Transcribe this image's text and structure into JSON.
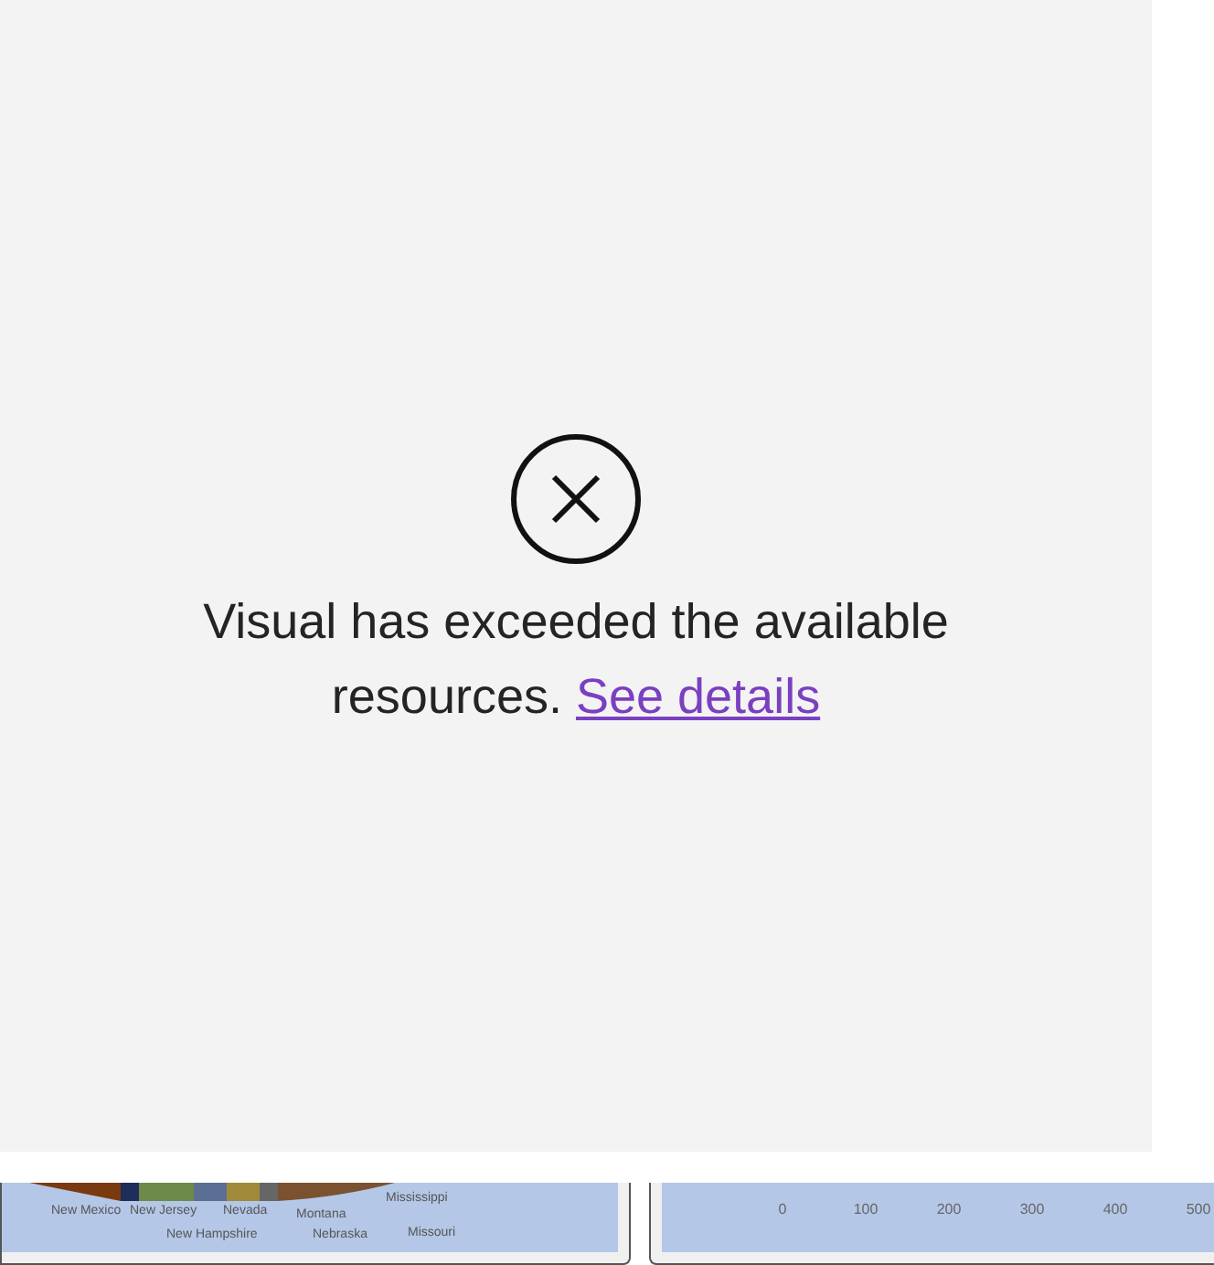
{
  "error": {
    "message": "Visual has exceeded the available resources.",
    "link": "See details"
  },
  "pie_chart": {
    "labels": [
      "New Mexico",
      "New Jersey",
      "Nevada",
      "Montana",
      "Mississippi",
      "New Hampshire",
      "Nebraska",
      "Missouri"
    ]
  },
  "bar_chart": {
    "axis_ticks": [
      "0",
      "100",
      "200",
      "300",
      "400",
      "500"
    ]
  }
}
